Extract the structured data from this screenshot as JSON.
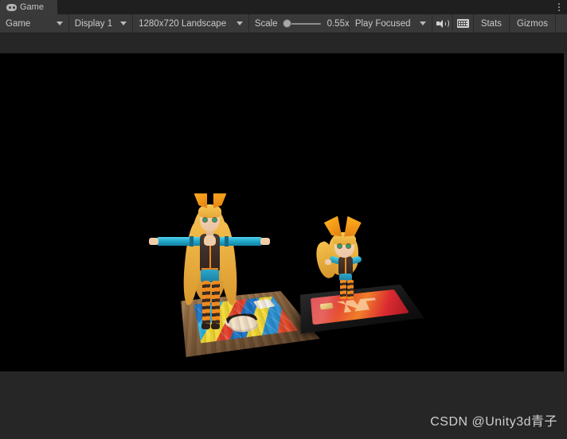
{
  "window": {
    "tab": {
      "label": "Game",
      "icon": "gamepad-icon"
    },
    "overflow_menu": "⋮"
  },
  "toolbar": {
    "view_mode": {
      "label": "Game",
      "icon": "chevron-down-icon"
    },
    "display": {
      "label": "Display 1",
      "icon": "chevron-down-icon"
    },
    "aspect_ratio": {
      "label": "1280x720 Landscape",
      "icon": "chevron-down-icon"
    },
    "scale": {
      "label": "Scale",
      "value": "0.55x",
      "slider_percent": 6,
      "min": 0.1,
      "max": 5
    },
    "play_mode": {
      "label": "Play Focused",
      "icon": "chevron-down-icon"
    },
    "mute_audio": {
      "icon": "speaker-icon",
      "tooltip": "Mute Audio"
    },
    "stats_grid": {
      "icon": "grid-icon"
    },
    "stats": {
      "label": "Stats"
    },
    "gizmos": {
      "label": "Gizmos",
      "icon": "chevron-down-icon"
    }
  },
  "game_view": {
    "background_color": "#000000",
    "resolution": "1280x720",
    "objects": [
      {
        "name": "character-tall-tpose",
        "description": "Blonde anime girl in T-pose with orange hair bows, cyan arm sleeves, brown vest with orange zipper, blue shorts and orange-black striped leggings",
        "platform": "wooden-board-with-manga-card"
      },
      {
        "name": "character-chibi",
        "description": "Chibi version of the blonde anime girl with orange bows and striped leggings",
        "platform": "black-mat-with-vip-card"
      }
    ]
  },
  "watermark": {
    "text": "CSDN @Unity3d青子"
  },
  "colors": {
    "toolbar_bg": "#393939",
    "tab_bg": "#3a3a3a",
    "tab_bar_bg": "#1f1f1f",
    "panel_bg": "#262626",
    "game_bg": "#000000",
    "text": "#c9c9c9",
    "accent_orange": "#f08a1e",
    "accent_cyan": "#22aacb"
  }
}
